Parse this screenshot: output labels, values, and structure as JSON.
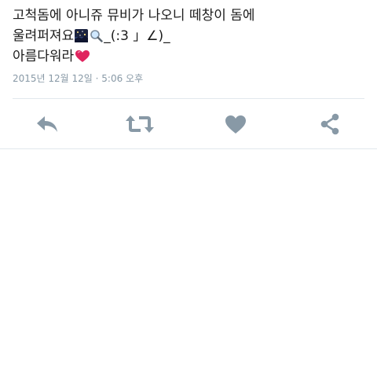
{
  "tweet": {
    "line1": "고척돔에 아니쥬 뮤비가 나오니 떼창이 돔에",
    "line2_text": "울려퍼져요",
    "line2_kaomoji": "_(:3 」∠)_",
    "line3_text": "아름다워라",
    "emojis": [
      "night-sky-emoji",
      "magnifying-glass-emoji",
      "heart-emoji"
    ]
  },
  "timestamp": "2015년 12월 12일 · 5:06 오후",
  "actions": {
    "icons": [
      "reply-icon",
      "retweet-icon",
      "like-icon",
      "share-icon"
    ],
    "icon_color": "#8899a6"
  },
  "colors": {
    "text": "#1c1c1c",
    "secondary": "#8899a6",
    "divider": "#e1e8ed",
    "heart": "#e0245e"
  }
}
